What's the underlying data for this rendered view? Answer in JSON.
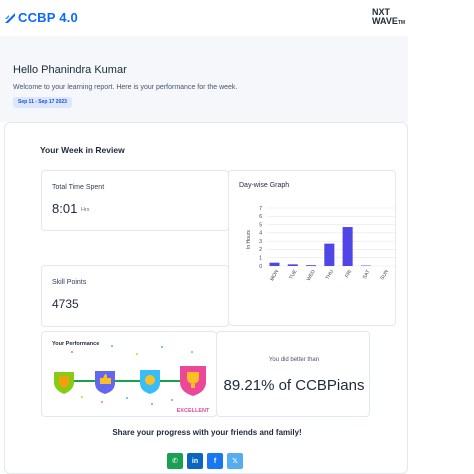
{
  "brand": {
    "ccbp_label": "CCBP 4.0",
    "nxt_line1": "NXT",
    "nxt_line2": "WAVE",
    "nxt_tm": "TM",
    "accent": "#0b69ff"
  },
  "hero": {
    "greeting": "Hello Phanindra Kumar",
    "subtitle": "Welcome to your learning report. Here is your performance for the week.",
    "date_range": "Sep 11 - Sep 17 2023"
  },
  "report": {
    "title": "Your Week in Review",
    "time_spent": {
      "label": "Total Time Spent",
      "value": "8:01",
      "unit": "Hrs"
    },
    "skill_points": {
      "label": "Skill Points",
      "value": "4735"
    },
    "performance": {
      "title": "Your Performance",
      "level_icons": [
        "shield-badge-icon",
        "thumbs-up-badge-icon",
        "medal-badge-icon",
        "trophy-badge-icon"
      ],
      "current_level": "EXCELLENT"
    },
    "comparison": {
      "label": "You did better than",
      "value": "89.21% of CCBPians"
    }
  },
  "chart_data": {
    "type": "bar",
    "title": "Day-wise Graph",
    "ylabel": "In Hours",
    "xlabel": "",
    "categories": [
      "MON",
      "TUE",
      "WED",
      "THU",
      "FRI",
      "SAT",
      "SUN"
    ],
    "values": [
      0.4,
      0.2,
      0.1,
      2.7,
      4.7,
      0.05,
      0
    ],
    "ylim": [
      0,
      7
    ],
    "yticks": [
      0,
      1,
      2,
      3,
      4,
      5,
      6,
      7
    ],
    "grid": true,
    "bar_color": "#4f46e5"
  },
  "share": {
    "text": "Share your progress with your friends and family!",
    "buttons": [
      {
        "name": "whatsapp",
        "glyph": "✆"
      },
      {
        "name": "linkedin",
        "glyph": "in"
      },
      {
        "name": "facebook",
        "glyph": "f"
      },
      {
        "name": "twitter",
        "glyph": "𝕏"
      }
    ]
  }
}
